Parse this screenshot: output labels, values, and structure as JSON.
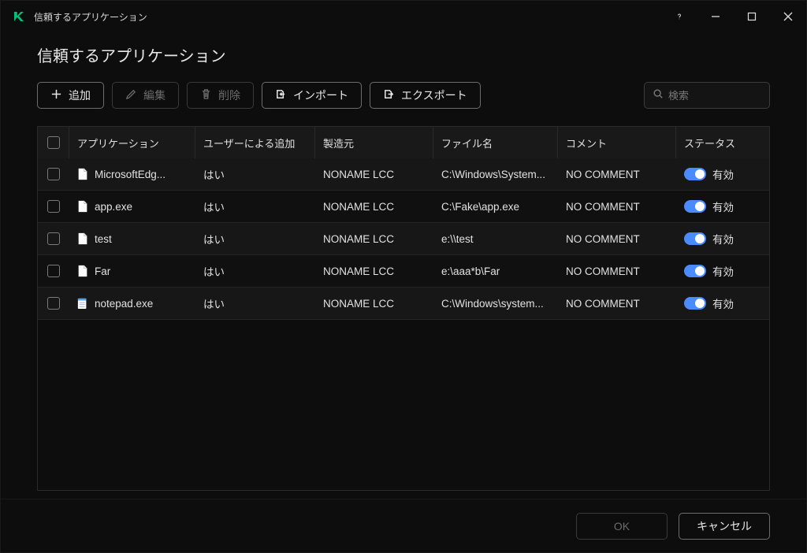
{
  "titlebar": {
    "title": "信頼するアプリケーション"
  },
  "page_title": "信頼するアプリケーション",
  "toolbar": {
    "add": "追加",
    "edit": "編集",
    "delete": "削除",
    "import": "インポート",
    "export": "エクスポート"
  },
  "search": {
    "placeholder": "検索"
  },
  "columns": {
    "app": "アプリケーション",
    "user_added": "ユーザーによる追加",
    "manufacturer": "製造元",
    "file_name": "ファイル名",
    "comment": "コメント",
    "status": "ステータス"
  },
  "status_label": "有効",
  "rows": [
    {
      "app": "MicrosoftEdg...",
      "user_added": "はい",
      "manufacturer": "NONAME LCC",
      "file": "C:\\Windows\\System...",
      "comment": "NO COMMENT",
      "enabled": true,
      "icon": "generic"
    },
    {
      "app": "app.exe",
      "user_added": "はい",
      "manufacturer": "NONAME LCC",
      "file": "C:\\Fake\\app.exe",
      "comment": "NO COMMENT",
      "enabled": true,
      "icon": "generic"
    },
    {
      "app": "test",
      "user_added": "はい",
      "manufacturer": "NONAME LCC",
      "file": "e:\\\\test",
      "comment": "NO COMMENT",
      "enabled": true,
      "icon": "generic"
    },
    {
      "app": "Far",
      "user_added": "はい",
      "manufacturer": "NONAME LCC",
      "file": "e:\\aaa*b\\Far",
      "comment": "NO COMMENT",
      "enabled": true,
      "icon": "generic"
    },
    {
      "app": "notepad.exe",
      "user_added": "はい",
      "manufacturer": "NONAME LCC",
      "file": "C:\\Windows\\system...",
      "comment": "NO COMMENT",
      "enabled": true,
      "icon": "notepad"
    }
  ],
  "footer": {
    "ok": "OK",
    "cancel": "キャンセル"
  }
}
